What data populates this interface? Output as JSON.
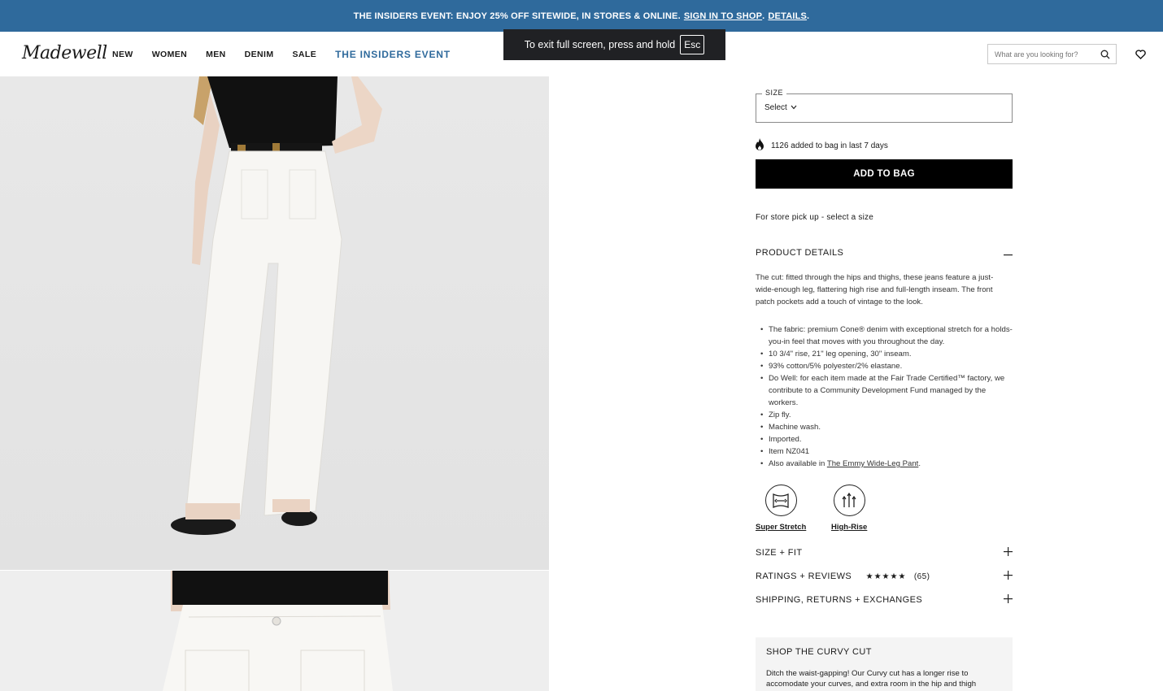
{
  "promo": {
    "text": "THE INSIDERS EVENT: ENJOY 25% OFF SITEWIDE, IN STORES & ONLINE.",
    "sign_in": "SIGN IN TO SHOP",
    "dot": ".",
    "details": "DETAILS",
    "end": "."
  },
  "header": {
    "logo": "Madewell",
    "nav": [
      "NEW",
      "WOMEN",
      "MEN",
      "DENIM",
      "SALE"
    ],
    "nav_highlight": "THE INSIDERS EVENT",
    "search_placeholder": "What are you looking for?"
  },
  "fullscreen_toast": {
    "text": "To exit full screen, press and hold",
    "key": "Esc"
  },
  "product": {
    "size_label": "SIZE",
    "size_value": "Select",
    "added_text": "1126 added to bag in last 7 days",
    "add_button": "ADD TO BAG",
    "pickup": "For store pick up - select a size",
    "details_heading": "PRODUCT DETAILS",
    "description": "The cut: fitted through the hips and thighs, these jeans feature a just-wide-enough leg, flattering high rise and full-length inseam. The front patch pockets add a touch of vintage to the look.",
    "bullets": [
      "The fabric: premium Cone® denim with exceptional stretch for a holds-you-in feel that moves with you throughout the day.",
      "10 3/4\" rise, 21\" leg opening, 30\" inseam.",
      "93% cotton/5% polyester/2% elastane.",
      "Do Well: for each item made at the Fair Trade Certified™ factory, we contribute to a Community Development Fund managed by the workers.",
      "Zip fly.",
      "Machine wash.",
      "Imported.",
      "Item NZ041"
    ],
    "also_prefix": "Also available in ",
    "also_link": "The Emmy Wide-Leg Pant",
    "also_suffix": ".",
    "features": [
      "Super Stretch",
      "High-Rise"
    ],
    "size_fit": "SIZE + FIT",
    "ratings": "RATINGS + REVIEWS",
    "stars": "★★★★★",
    "review_count": "(65)",
    "shipping": "SHIPPING, RETURNS + EXCHANGES",
    "curvy_heading": "SHOP THE CURVY CUT",
    "curvy_text": "Ditch the waist-gapping! Our Curvy cut has a longer rise to accomodate your curves, and extra room in the hip and thigh"
  }
}
